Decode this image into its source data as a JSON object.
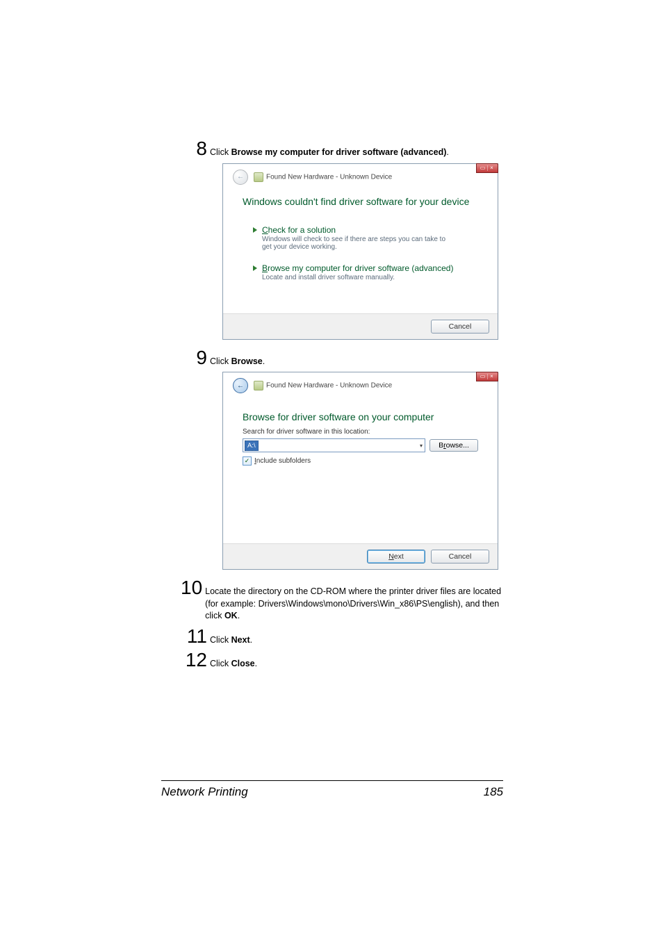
{
  "steps": {
    "s8": {
      "num": "8",
      "text_prefix": "Click ",
      "text_bold": "Browse my computer for driver software (advanced)",
      "text_suffix": "."
    },
    "s9": {
      "num": "9",
      "text_prefix": "Click ",
      "text_bold": "Browse",
      "text_suffix": "."
    },
    "s10": {
      "num": "10",
      "text": "Locate the directory on the CD-ROM where the printer driver files are located (for example: Drivers\\Windows\\mono\\Drivers\\Win_x86\\PS\\english), and then click ",
      "text_bold": "OK",
      "text_suffix": "."
    },
    "s11": {
      "num": "11",
      "text_prefix": "Click ",
      "text_bold": "Next",
      "text_suffix": "."
    },
    "s12": {
      "num": "12",
      "text_prefix": "Click ",
      "text_bold": "Close",
      "text_suffix": "."
    }
  },
  "dialog1": {
    "title": "Found New Hardware - Unknown Device",
    "heading": "Windows couldn't find driver software for your device",
    "opt1": {
      "prefix_ul": "C",
      "rest": "heck for a solution",
      "desc": "Windows will check to see if there are steps you can take to get your device working."
    },
    "opt2": {
      "prefix_ul": "B",
      "rest": "rowse my computer for driver software (advanced)",
      "desc": "Locate and install driver software manually."
    },
    "cancel": "Cancel",
    "close_min": "–",
    "close_x": "×"
  },
  "dialog2": {
    "title": "Found New Hardware - Unknown Device",
    "heading": "Browse for driver software on your computer",
    "label": "Search for driver software in this location:",
    "combo_value": "A:\\",
    "combo_dd": "▾",
    "browse_btn_prefix": "B",
    "browse_btn_ul": "r",
    "browse_btn_suffix": "owse...",
    "chk_prefix_ul": "I",
    "chk_rest": "nclude subfolders",
    "next_prefix_ul": "N",
    "next_rest": "ext",
    "cancel": "Cancel",
    "close_x": "×"
  },
  "footer": {
    "title": "Network Printing",
    "page": "185"
  }
}
